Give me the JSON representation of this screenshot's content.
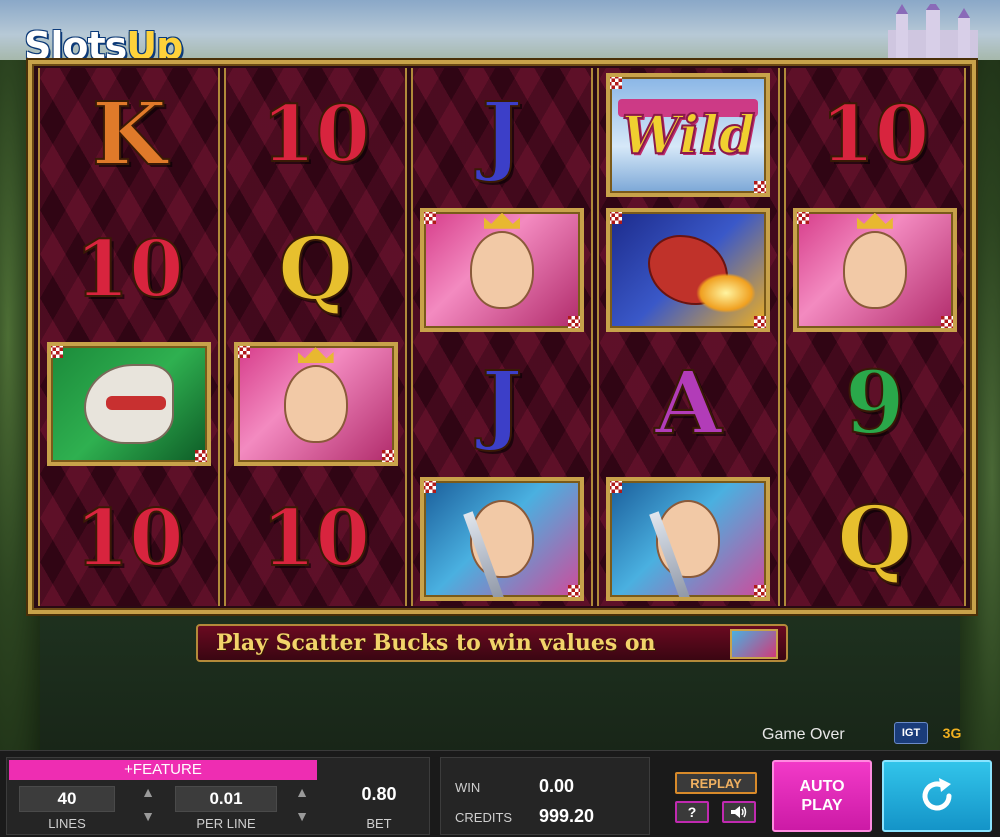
{
  "branding": {
    "logo_part1": "Slots",
    "logo_part2": "Up",
    "provider": "IGT",
    "studio_mark": "3G"
  },
  "reels": [
    [
      "K",
      "10",
      "horse",
      "10"
    ],
    [
      "10",
      "Q",
      "princess",
      "10"
    ],
    [
      "J",
      "princess",
      "J",
      "knight"
    ],
    [
      "wild",
      "dragon",
      "A",
      "knight"
    ],
    [
      "10",
      "princess",
      "9",
      "Q"
    ]
  ],
  "wild_label": "Wild",
  "scatter_message": "Play Scatter Bucks to win values on",
  "status": "Game Over",
  "controls": {
    "feature_label": "+FEATURE",
    "lines_value": "40",
    "lines_label": "LINES",
    "per_line_value": "0.01",
    "per_line_label": "PER LINE",
    "bet_value": "0.80",
    "bet_label": "BET",
    "win_label": "WIN",
    "win_value": "0.00",
    "credits_label": "CREDITS",
    "credits_value": "999.20",
    "replay_label": "REPLAY",
    "help_label": "?",
    "autoplay_line1": "AUTO",
    "autoplay_line2": "PLAY"
  },
  "colors": {
    "feature": "#ee2db2",
    "autoplay": "#e02ab8",
    "spin": "#22acd8",
    "frame_gold": "#c8a24a"
  }
}
